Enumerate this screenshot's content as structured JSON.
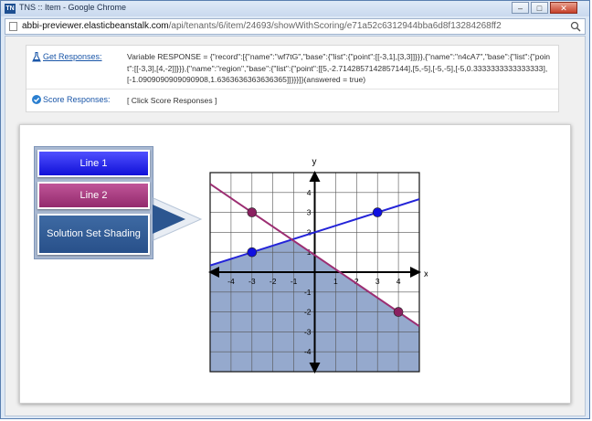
{
  "window": {
    "title": "TNS :: Item - Google Chrome",
    "app_icon_text": "TN",
    "minimize": "–",
    "maximize": "□",
    "close": "✕"
  },
  "address": {
    "host": "abbi-previewer.elasticbeanstalk.com",
    "path": "/api/tenants/6/item/24693/showWithScoring/e71a52c6312944bba6d8f13284268ff2"
  },
  "responses": {
    "get_label": "Get Responses:",
    "get_value": "Variable RESPONSE = {\"record\":[{\"name\":\"wf7tG\",\"base\":{\"list\":{\"point\":[[-3,1],[3,3]]}}},{\"name\":\"n4cA7\",\"base\":{\"list\":{\"point\":[[-3,3],[4,-2]]}}},{\"name\":\"region\",\"base\":{\"list\":{\"point\":[[5,-2.7142857142857144],[5,-5],[-5,-5],[-5,0.3333333333333333],[-1.0909090909090908,1.6363636363636365]]}}}]}(answered = true)",
    "score_label": "Score Responses:",
    "score_value": "[ Click Score Responses ]"
  },
  "tools": {
    "line1": "Line 1",
    "line2": "Line 2",
    "shading": "Solution Set Shading"
  },
  "chart_data": {
    "type": "scatter",
    "title": "",
    "xlabel": "x",
    "ylabel": "y",
    "xlim": [
      -5,
      5
    ],
    "ylim": [
      -5,
      5
    ],
    "x_ticks": [
      -4,
      -3,
      -2,
      -1,
      1,
      2,
      3,
      4
    ],
    "y_ticks": [
      -4,
      -3,
      -2,
      -1,
      1,
      2,
      3,
      4
    ],
    "grid": true,
    "colors": {
      "line1": "#2323d8",
      "line2": "#9c2e72",
      "region": "#7a94c0",
      "point1": "#1010e0",
      "point2": "#8a2060"
    },
    "series": [
      {
        "points": [
          [
            -3,
            1
          ],
          [
            3,
            3
          ]
        ]
      },
      {
        "points": [
          [
            -3,
            3
          ],
          [
            4,
            -2
          ]
        ]
      }
    ],
    "region": [
      [
        5,
        -2.7142857142857144
      ],
      [
        5,
        -5
      ],
      [
        -5,
        -5
      ],
      [
        -5,
        0.3333333333333333
      ],
      [
        -1.0909090909090908,
        1.6363636363636365
      ]
    ]
  }
}
